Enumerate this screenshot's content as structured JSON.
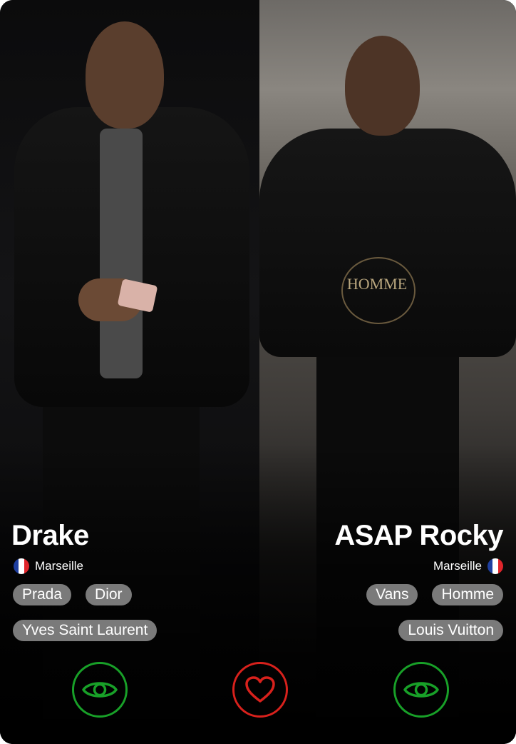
{
  "colors": {
    "eye_ring": "#18a028",
    "heart_ring": "#d8211c",
    "tag_bg": "#7a7a7a",
    "text": "#ffffff"
  },
  "profiles": [
    {
      "name": "Drake",
      "location": "Marseille",
      "flag": "france-flag-icon",
      "tags": [
        "Prada",
        "Dior",
        "Yves Saint Laurent"
      ]
    },
    {
      "name": "ASAP Rocky",
      "location": "Marseille",
      "flag": "france-flag-icon",
      "tags": [
        "Vans",
        "Homme",
        "Louis Vuitton"
      ],
      "shirt_print": "HOMME"
    }
  ],
  "actions": [
    {
      "icon": "eye-icon"
    },
    {
      "icon": "heart-icon"
    },
    {
      "icon": "eye-icon"
    }
  ]
}
